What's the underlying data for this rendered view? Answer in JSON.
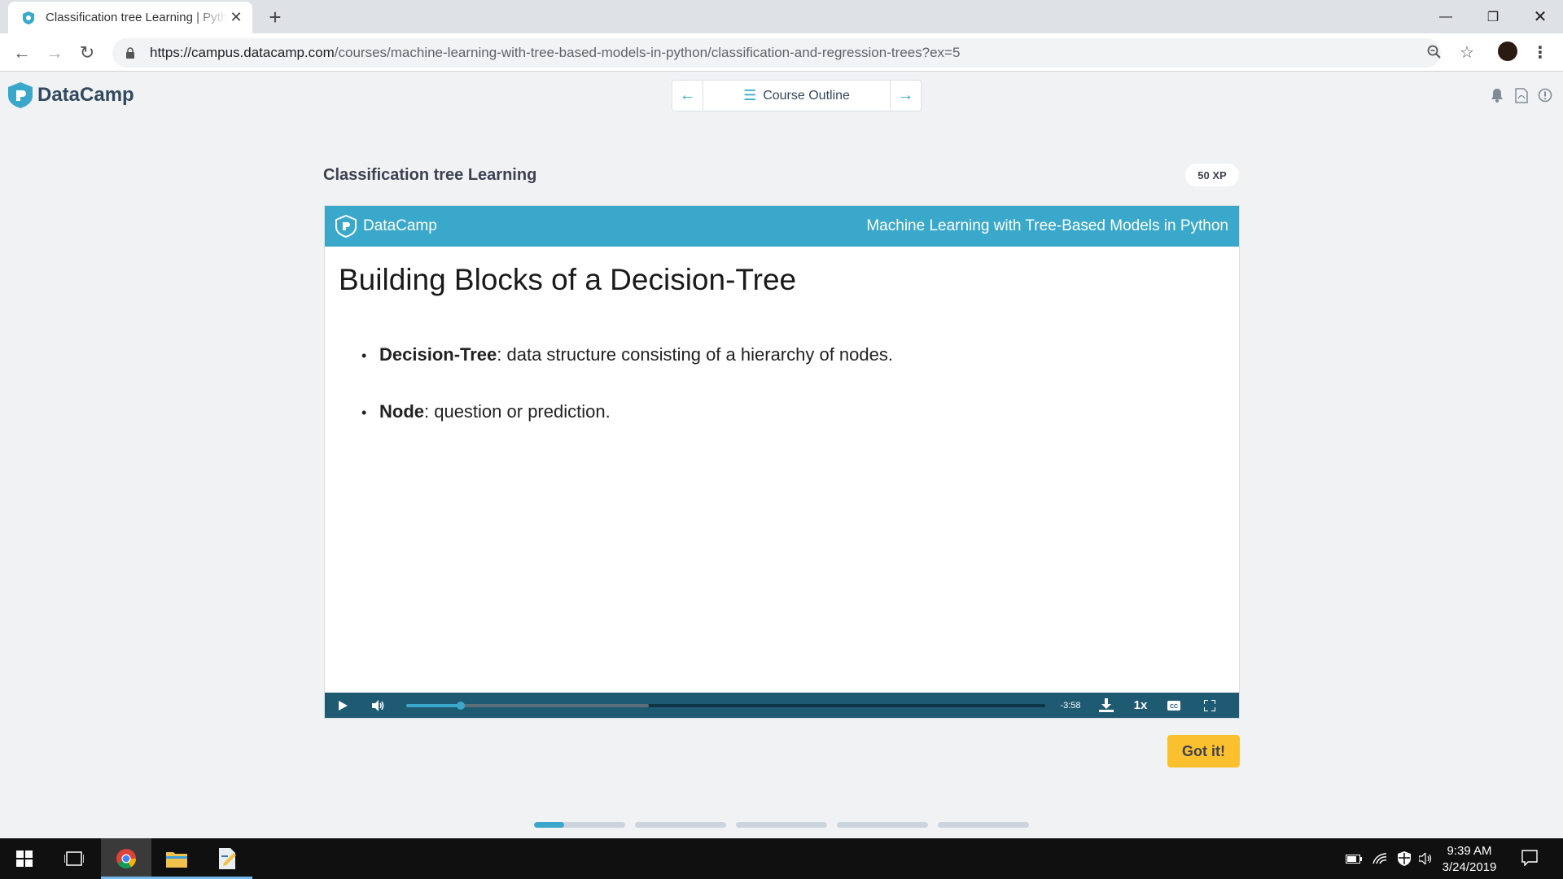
{
  "browser": {
    "tab_title": "Classification tree Learning | Python",
    "url_host": "https://campus.datacamp.com",
    "url_path": "/courses/machine-learning-with-tree-based-models-in-python/classification-and-regression-trees?ex=5"
  },
  "app": {
    "brand": "DataCamp",
    "course_outline_label": "Course Outline"
  },
  "exercise": {
    "title": "Classification tree Learning",
    "xp": "50 XP",
    "got_it_label": "Got it!"
  },
  "slide": {
    "brand": "DataCamp",
    "course_name": "Machine Learning with Tree-Based Models in Python",
    "heading": "Building Blocks of a Decision-Tree",
    "bullets": [
      {
        "term": "Decision-Tree",
        "text": ": data structure consisting of a hierarchy of nodes."
      },
      {
        "term": "Node",
        "text": ": question or prediction."
      }
    ]
  },
  "player": {
    "time_remaining": "-3:58",
    "speed": "1x",
    "played_fraction": 0.085,
    "buffered_fraction": 0.38
  },
  "exercise_progress": {
    "segments": 5,
    "current_fill": 0.33
  },
  "taskbar": {
    "time": "9:39 AM",
    "date": "3/24/2019"
  },
  "colors": {
    "accent": "#3aa8cb",
    "player_bar": "#1f5a73",
    "button": "#fbc02d"
  }
}
